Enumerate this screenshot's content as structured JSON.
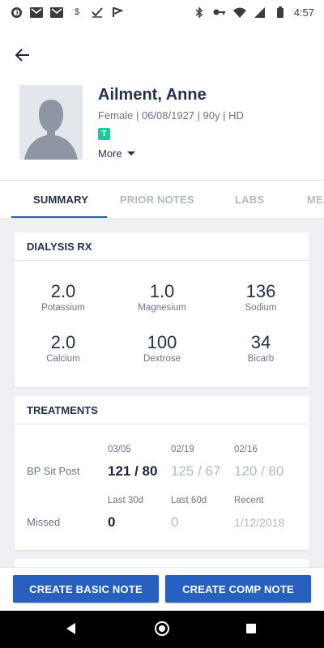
{
  "status_bar": {
    "time": "4:57",
    "left_icons": [
      "opera-icon",
      "gmail-icon",
      "gmail-icon",
      "dollar-icon",
      "checkmark-icon",
      "checkmark-flag-icon"
    ],
    "right_icons": [
      "bluetooth-icon",
      "key-icon",
      "wifi-icon",
      "signal-icon",
      "battery-icon"
    ]
  },
  "patient": {
    "name": "Ailment, Anne",
    "meta": "Female | 06/08/1927 | 90y  | HD",
    "badge": "T",
    "more_label": "More",
    "badge_color": "#1ec99a"
  },
  "tabs": [
    {
      "label": "SUMMARY",
      "active": true
    },
    {
      "label": "PRIOR NOTES",
      "active": false
    },
    {
      "label": "LABS",
      "active": false
    },
    {
      "label": "ME",
      "active": false
    }
  ],
  "dialysis_rx": {
    "title": "DIALYSIS RX",
    "items": [
      {
        "value": "2.0",
        "label": "Potassium"
      },
      {
        "value": "1.0",
        "label": "Magnesium"
      },
      {
        "value": "136",
        "label": "Sodium"
      },
      {
        "value": "2.0",
        "label": "Calcium"
      },
      {
        "value": "100",
        "label": "Dextrose"
      },
      {
        "value": "34",
        "label": "Bicarb"
      }
    ]
  },
  "treatments": {
    "title": "TREATMENTS",
    "bp": {
      "label": "BP Sit Post",
      "columns": [
        {
          "date": "03/05",
          "value": "121 / 80"
        },
        {
          "date": "02/19",
          "value": "125 / 67"
        },
        {
          "date": "02/16",
          "value": "120 / 80"
        }
      ]
    },
    "missed": {
      "label": "Missed",
      "columns": [
        {
          "header": "Last 30d",
          "value": "0"
        },
        {
          "header": "Last 60d",
          "value": "0"
        },
        {
          "header": "Recent",
          "value": "1/12/2018"
        }
      ]
    }
  },
  "actions": {
    "basic_note": "CREATE BASIC NOTE",
    "comp_note": "CREATE COMP NOTE"
  },
  "colors": {
    "primary_blue": "#2760bf",
    "tab_underline": "#2b5cb3",
    "background": "#eef0f3"
  }
}
